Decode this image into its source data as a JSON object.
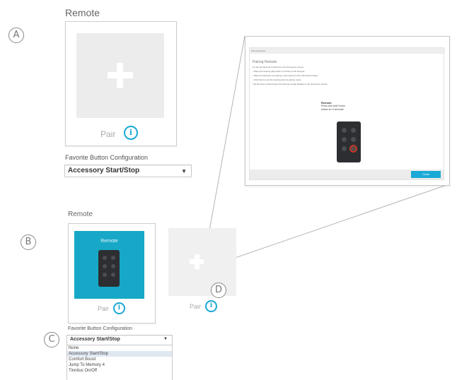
{
  "callouts": {
    "a": "A",
    "b": "B",
    "c": "C",
    "d": "D"
  },
  "section_a": {
    "title": "Remote",
    "pair_label": "Pair",
    "favorite_label": "Favorite Button Configuration",
    "favorite_value": "Accessory Start/Stop"
  },
  "section_b": {
    "title": "Remote",
    "card_label": "Remote",
    "pair_label": "Pair",
    "second_pair_label": "Pair",
    "favorite_label": "Favorite Button Configuration",
    "favorite_value": "Accessory Start/Stop",
    "options": [
      "None",
      "Accessory Start/Stop",
      "Comfort Boost",
      "Jump To Memory 4",
      "Tinnitus On/Off"
    ],
    "selected_option": "Accessory Start/Stop"
  },
  "popup": {
    "window_title": "Pairing Remote",
    "heading": "Pairing Remote",
    "lines": [
      "To pair the Remote Control from the Accessory screen:",
      "• Place the hearing aids within 12 inches of the Remote",
      "• Place the Remote into pairing mode based on the instructions below",
      "• Click Start to put the hearing aid into pairing mode",
      "The Remote is paired when the Remote image displays in the Accessory screen"
    ],
    "remote_title": "Remote",
    "remote_desc": "Press and hold Home button for 3 seconds",
    "close_label": "Close"
  },
  "colors": {
    "accent": "#1aa9d6",
    "teal_card": "#16a8c6"
  },
  "icons": {
    "info": "info-icon",
    "plus": "plus-icon",
    "caret": "chevron-down-icon"
  }
}
